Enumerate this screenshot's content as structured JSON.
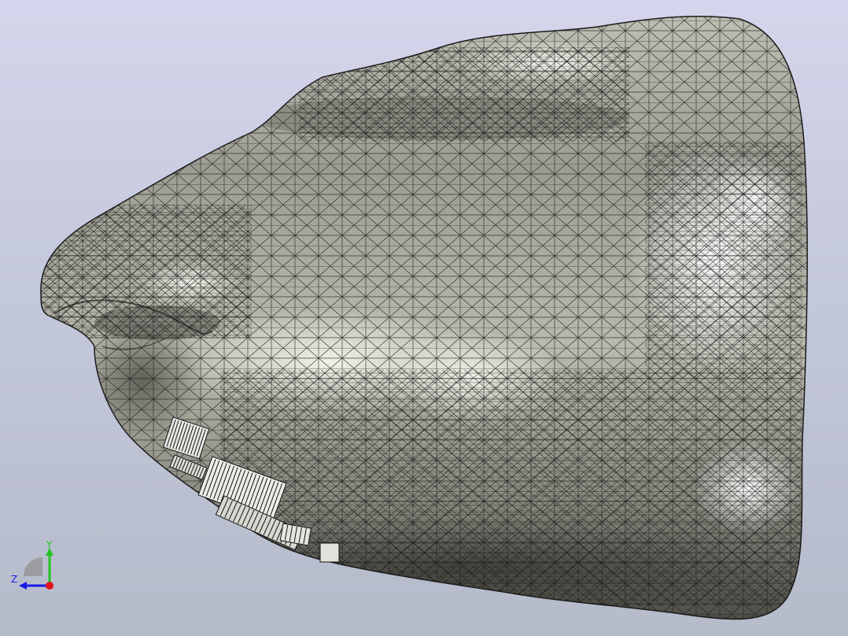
{
  "viewport": {
    "background_top": "#d5d5ec",
    "background_bottom": "#b5bbc9"
  },
  "model": {
    "surface_color": "#a8a89c",
    "highlight_color": "#f4f4ee",
    "shadow_color": "#3e3e38",
    "mesh_line_color": "#1a1a1a"
  },
  "axis_triad": {
    "y_label": "Y",
    "z_label": "Z",
    "x_color": "#e0101c",
    "y_color": "#22c422",
    "z_color": "#1a1ae6"
  }
}
